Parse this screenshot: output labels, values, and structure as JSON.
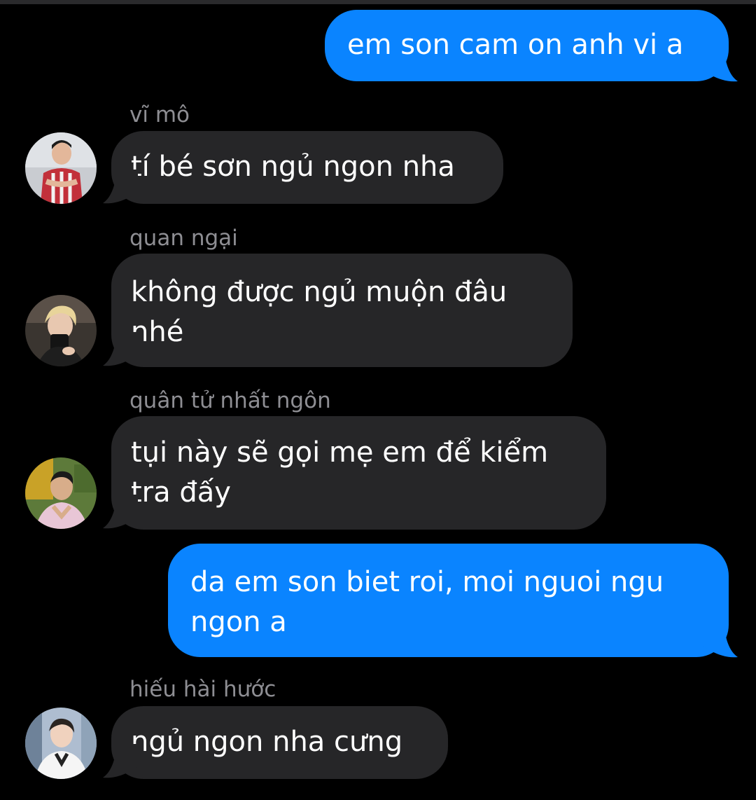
{
  "colors": {
    "background": "#000000",
    "outgoing_bubble": "#0a84ff",
    "incoming_bubble": "#262628",
    "sender_name": "#8e8e93",
    "message_text": "#ffffff"
  },
  "messages": [
    {
      "direction": "outgoing",
      "text": "em son cam on anh vi a"
    },
    {
      "direction": "incoming",
      "sender": "vĩ mô",
      "avatar_icon": "avatar-photo-icon",
      "text": "tí bé sơn ngủ ngon nha"
    },
    {
      "direction": "incoming",
      "sender": "quan ngại",
      "avatar_icon": "avatar-photo-icon",
      "lines": [
        "không được ngủ muộn đâu",
        "nhé"
      ]
    },
    {
      "direction": "incoming",
      "sender": "quân tử nhất ngôn",
      "avatar_icon": "avatar-photo-icon",
      "lines": [
        "tụi này sẽ gọi mẹ em để kiểm",
        "tra đấy"
      ]
    },
    {
      "direction": "outgoing",
      "lines": [
        "da em son biet roi, moi nguoi ngu",
        "ngon a"
      ]
    },
    {
      "direction": "incoming",
      "sender": "hiếu hài hước",
      "avatar_icon": "avatar-photo-icon",
      "text": "ngủ ngon nha cưng"
    }
  ]
}
